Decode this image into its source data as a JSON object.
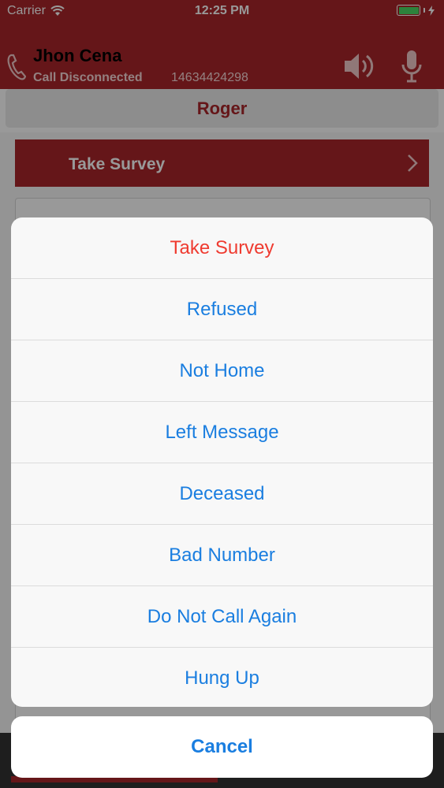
{
  "status_bar": {
    "carrier": "Carrier",
    "time": "12:25 PM",
    "battery_color": "#4cd964"
  },
  "call_header": {
    "caller_name": "Jhon Cena",
    "status": "Call Disconnected",
    "number": "14634424298",
    "icons": [
      "phone-icon",
      "speaker-icon",
      "microphone-icon"
    ],
    "accent_color": "#a8262a"
  },
  "contact_bar": {
    "name": "Roger"
  },
  "survey_bar": {
    "label": "Take Survey"
  },
  "action_sheet": {
    "items": [
      {
        "label": "Take Survey",
        "color": "#ef3b30"
      },
      {
        "label": "Refused"
      },
      {
        "label": "Not Home"
      },
      {
        "label": "Left Message"
      },
      {
        "label": "Deceased"
      },
      {
        "label": "Bad Number"
      },
      {
        "label": "Do Not Call Again"
      },
      {
        "label": "Hung Up"
      }
    ],
    "cancel_label": "Cancel",
    "action_color": "#1a7ee0"
  }
}
